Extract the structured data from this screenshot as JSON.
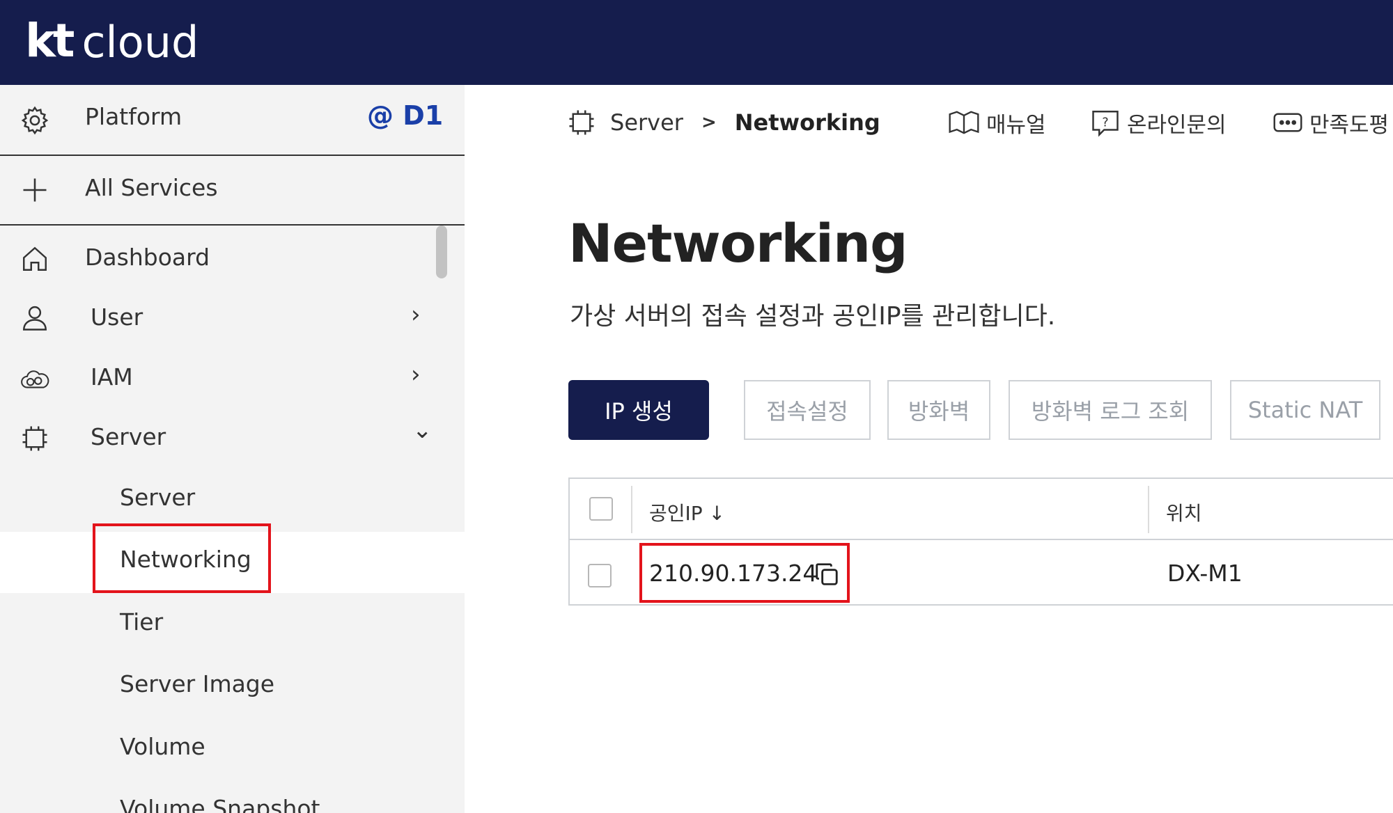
{
  "header": {
    "logo_kt": "kt",
    "logo_cloud": "cloud",
    "bg_color": "#151d4d"
  },
  "sidebar": {
    "platform_label": "Platform",
    "region": "@ D1",
    "all_services": "All Services",
    "items": [
      {
        "label": "Dashboard",
        "icon": "home-icon"
      },
      {
        "label": "User",
        "icon": "user-icon",
        "chevron": "›"
      },
      {
        "label": "IAM",
        "icon": "cloud-icon",
        "chevron": "›"
      },
      {
        "label": "Server",
        "icon": "chip-icon",
        "chevron": "⌄"
      }
    ],
    "sub_items": [
      "Server",
      "Networking",
      "Tier",
      "Server Image",
      "Volume",
      "Volume Snapshot"
    ],
    "active_sub": "Networking"
  },
  "breadcrumb": {
    "parent": "Server",
    "separator": ">",
    "current": "Networking"
  },
  "utility": {
    "manual": "매뉴얼",
    "inquiry": "온라인문의",
    "survey": "만족도평"
  },
  "page": {
    "title": "Networking",
    "description": "가상 서버의 접속 설정과 공인IP를 관리합니다."
  },
  "buttons": {
    "create_ip": "IP 생성",
    "access_settings": "접속설정",
    "firewall": "방화벽",
    "firewall_log": "방화벽 로그 조회",
    "static_nat": "Static NAT"
  },
  "table": {
    "columns": [
      "공인IP ↓",
      "위치"
    ],
    "rows": [
      {
        "ip": "210.90.173.24",
        "location": "DX-M1"
      }
    ]
  },
  "colors": {
    "accent": "#151d4d",
    "highlight": "#e3131b",
    "region": "#1a3fa8"
  }
}
